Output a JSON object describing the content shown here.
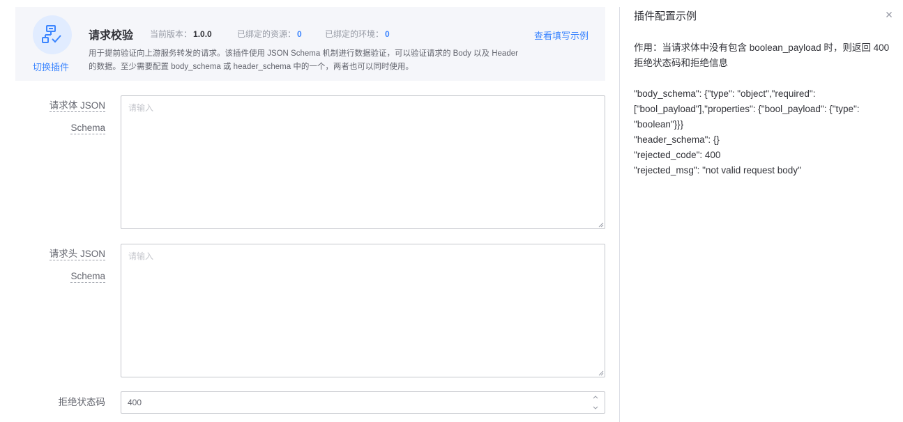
{
  "plugin": {
    "switch_label": "切换插件",
    "title": "请求校验",
    "version_label": "当前版本：",
    "version_value": "1.0.0",
    "resources_label": "已绑定的资源：",
    "resources_value": "0",
    "env_label": "已绑定的环境：",
    "env_value": "0",
    "example_link": "查看填写示例",
    "description": "用于提前验证向上游服务转发的请求。该插件使用 JSON Schema 机制进行数据验证，可以验证请求的 Body 以及 Header 的数据。至少需要配置 body_schema 或 header_schema 中的一个，两者也可以同时使用。"
  },
  "form": {
    "body_schema": {
      "label_line1": "请求体 JSON",
      "label_line2": "Schema",
      "placeholder": "请输入",
      "value": ""
    },
    "header_schema": {
      "label_line1": "请求头 JSON",
      "label_line2": "Schema",
      "placeholder": "请输入",
      "value": ""
    },
    "rejected_code": {
      "label": "拒绝状态码",
      "value": "400"
    }
  },
  "panel": {
    "title": "插件配置示例",
    "purpose": "作用：当请求体中没有包含 boolean_payload 时，则返回 400 拒绝状态码和拒绝信息",
    "code_lines": [
      "\"body_schema\": {\"type\": \"object\",\"required\": [\"bool_payload\"],\"properties\": {\"bool_payload\": {\"type\": \"boolean\"}}}",
      "\"header_schema\": {}",
      "\"rejected_code\": 400",
      "\"rejected_msg\": \"not valid request body\""
    ]
  },
  "colors": {
    "accent": "#3a84ff",
    "card_bg": "#f5f6fa",
    "icon_bg": "#e1ecff"
  },
  "icons": {
    "plugin": "flow-check-icon",
    "close": "close-icon",
    "stepper_up": "chevron-up-icon",
    "stepper_down": "chevron-down-icon"
  }
}
